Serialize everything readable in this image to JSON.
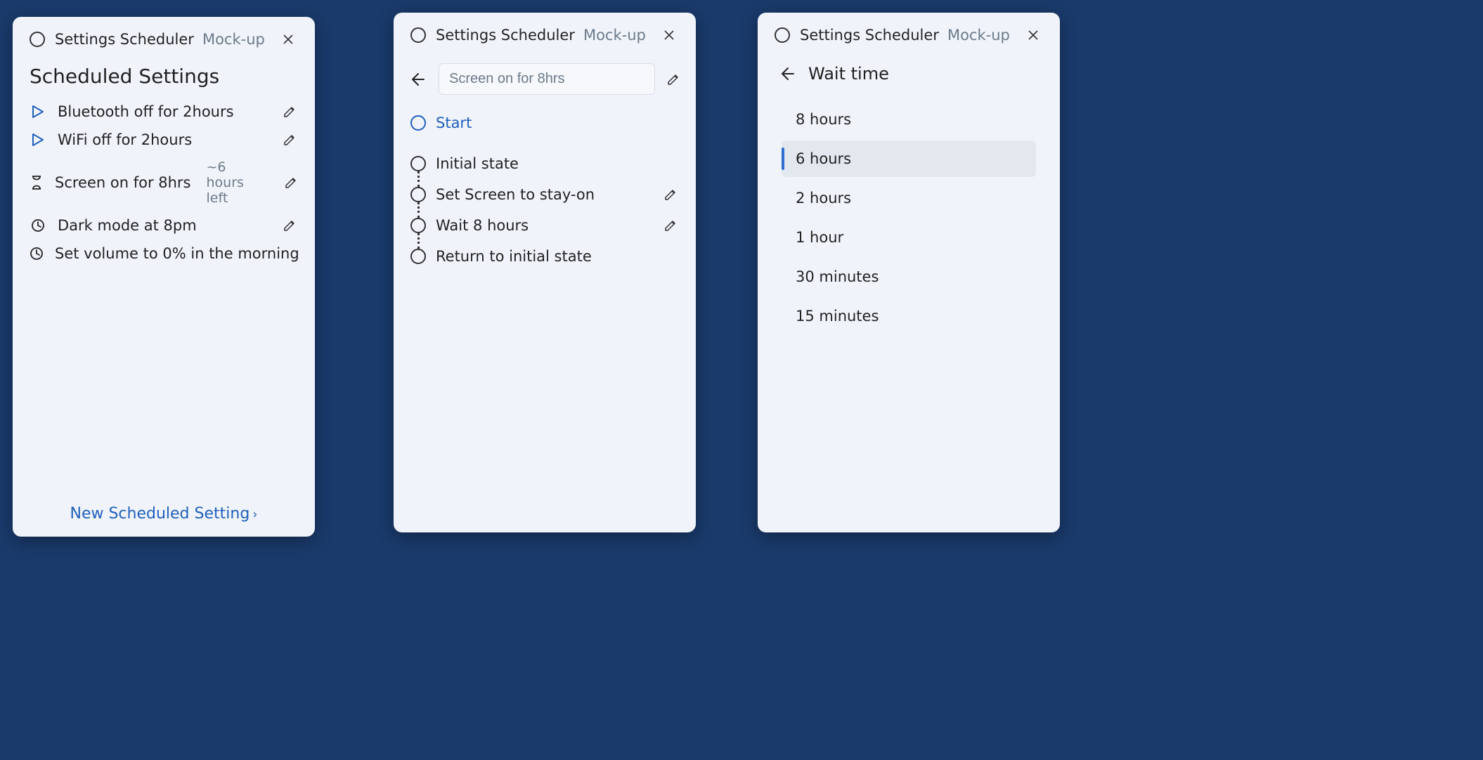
{
  "app": {
    "title": "Settings Scheduler",
    "subtitle": "Mock-up"
  },
  "panelA": {
    "heading": "Scheduled Settings",
    "items": [
      {
        "icon": "play",
        "label": "Bluetooth off for 2hours",
        "meta": ""
      },
      {
        "icon": "play",
        "label": "WiFi off for 2hours",
        "meta": ""
      },
      {
        "icon": "hourglass",
        "label": "Screen on for 8hrs",
        "meta": "~6 hours left"
      },
      {
        "icon": "clock",
        "label": "Dark mode at  8pm",
        "meta": ""
      },
      {
        "icon": "clock",
        "label": "Set volume to 0% in the morning",
        "meta": ""
      }
    ],
    "new_link": "New Scheduled Setting"
  },
  "panelB": {
    "name_value": "Screen on for 8hrs",
    "start_label": "Start",
    "steps": [
      {
        "label": "Initial state",
        "editable": false
      },
      {
        "label": "Set Screen to stay-on",
        "editable": true
      },
      {
        "label": "Wait 8 hours",
        "editable": true
      },
      {
        "label": "Return to initial state",
        "editable": false
      }
    ]
  },
  "panelC": {
    "heading": "Wait time",
    "options": [
      {
        "label": "8 hours",
        "selected": false
      },
      {
        "label": "6 hours",
        "selected": true
      },
      {
        "label": "2 hours",
        "selected": false
      },
      {
        "label": "1 hour",
        "selected": false
      },
      {
        "label": "30 minutes",
        "selected": false
      },
      {
        "label": "15 minutes",
        "selected": false
      }
    ]
  }
}
